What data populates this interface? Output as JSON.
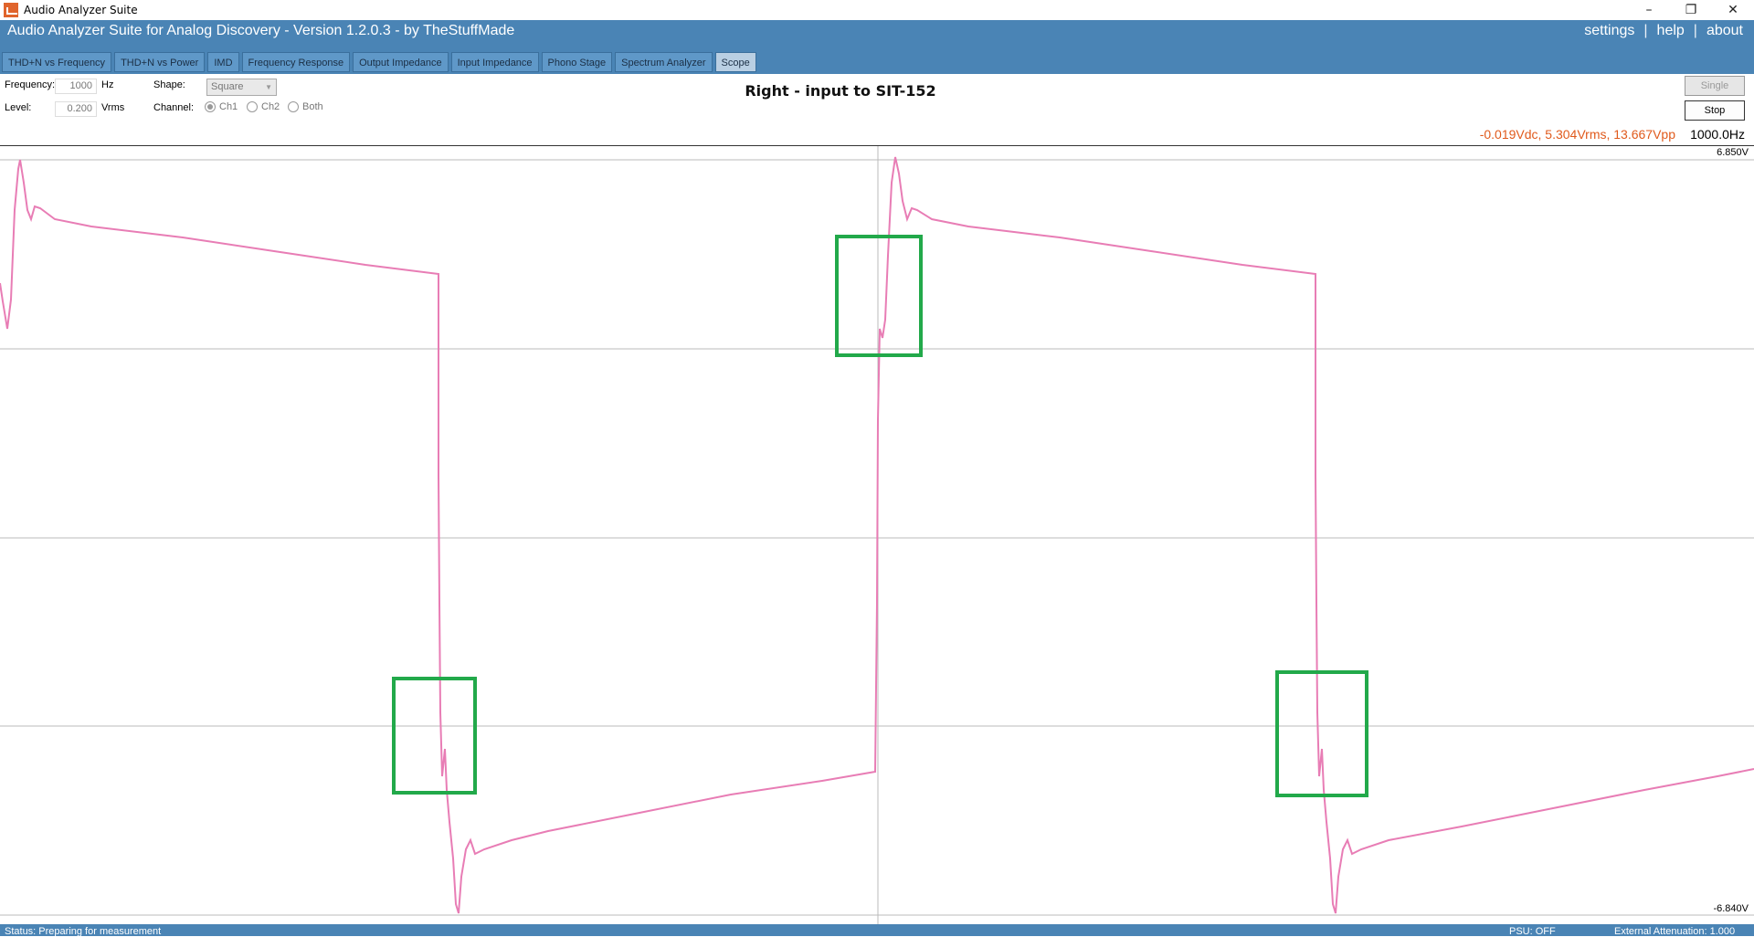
{
  "window": {
    "title": "Audio Analyzer Suite",
    "minimize": "–",
    "restore": "❐",
    "close": "✕"
  },
  "header": {
    "title": "Audio Analyzer Suite for Analog Discovery - Version   1.2.0.3   - by TheStuffMade",
    "links": {
      "settings": "settings",
      "sep": "|",
      "help": "help",
      "about": "about"
    }
  },
  "tabs": [
    {
      "label": "THD+N vs Frequency",
      "active": false
    },
    {
      "label": "THD+N vs Power",
      "active": false
    },
    {
      "label": "IMD",
      "active": false
    },
    {
      "label": "Frequency Response",
      "active": false
    },
    {
      "label": "Output Impedance",
      "active": false
    },
    {
      "label": "Input Impedance",
      "active": false
    },
    {
      "label": "Phono Stage",
      "active": false
    },
    {
      "label": "Spectrum Analyzer",
      "active": false
    },
    {
      "label": "Scope",
      "active": true
    }
  ],
  "controls": {
    "frequency_label": "Frequency:",
    "frequency_value": "1000",
    "frequency_unit": "Hz",
    "level_label": "Level:",
    "level_value": "0.200",
    "level_unit": "Vrms",
    "shape_label": "Shape:",
    "shape_value": "Square",
    "channel_label": "Channel:",
    "channel_options": [
      "Ch1",
      "Ch2",
      "Both"
    ],
    "channel_selected": "Ch1",
    "single_label": "Single",
    "stop_label": "Stop"
  },
  "plot": {
    "title": "Right - input to SIT-152",
    "measurement": "-0.019Vdc, 5.304Vrms, 13.667Vpp",
    "frequency_readout": "1000.0Hz",
    "ymax_label": "6.850V",
    "ymin_label": "-6.840V",
    "trace_color": "#e87db5",
    "highlight_color": "#22a94a"
  },
  "status": {
    "text": "Status: Preparing for measurement",
    "psu": "PSU: OFF",
    "attenuation": "External Attenuation: 1.000"
  }
}
